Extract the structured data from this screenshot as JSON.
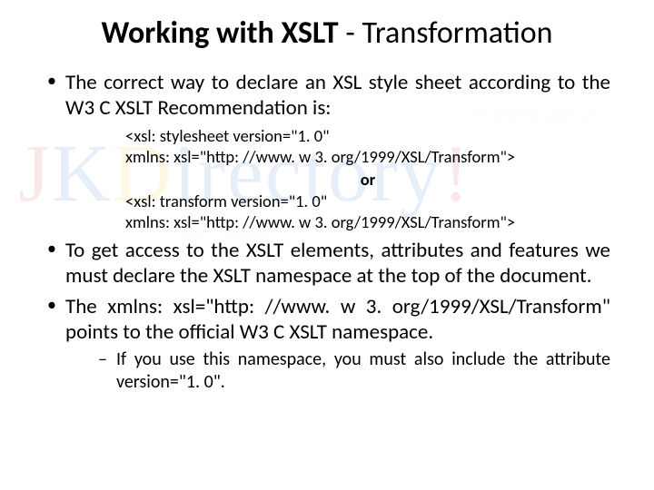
{
  "title": {
    "bold": "Working with XSLT",
    "rest": " - Transformation"
  },
  "bullets": {
    "b1": "The correct way to declare an XSL style sheet according to the W3 C XSLT Recommendation is:",
    "code1a": "<xsl: stylesheet version=\"1. 0\"",
    "code1b": "xmlns: xsl=\"http: //www. w 3. org/1999/XSL/Transform\">",
    "or": "or",
    "code2a": "<xsl: transform version=\"1. 0\"",
    "code2b": "xmlns: xsl=\"http: //www. w 3. org/1999/XSL/Transform\">",
    "b2": "To get access to the XSLT elements, attributes and features we must declare the XSLT namespace at the top of the document.",
    "b3": "The xmlns: xsl=\"http: //www. w 3. org/1999/XSL/Transform\" points to the official W3 C XSLT namespace.",
    "sub1": "If you use this namespace, you must also include the attribute version=\"1. 0\"."
  },
  "watermark": {
    "j": "J",
    "k": "K",
    "d": "D",
    "rest": "irectory",
    "bang": "!",
    "url1": "www.jkmaterials.yolasite.com",
    "url2": "www.jkdirectory.yolasite.com"
  }
}
